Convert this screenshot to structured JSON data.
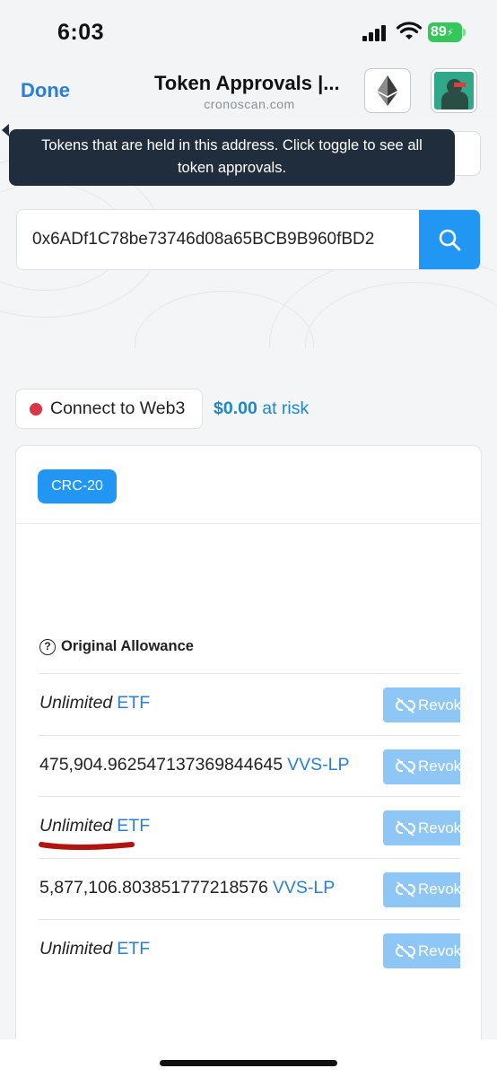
{
  "status_bar": {
    "time": "6:03",
    "battery": "89"
  },
  "nav": {
    "done_label": "Done",
    "title": "Token Approvals |...",
    "domain": "cronoscan.com"
  },
  "search": {
    "value": "0x6ADf1C78be73746d08a65BCB9B960fBD2"
  },
  "tooltip": {
    "text": "Tokens that are held in this address. Click toggle to see all token approvals."
  },
  "connect": {
    "label": "Connect to Web3"
  },
  "risk": {
    "amount": "$0.00",
    "label": " at risk"
  },
  "card": {
    "tab_label": "CRC-20",
    "column_header": "Original Allowance",
    "rows": [
      {
        "amount": "Unlimited",
        "token": "ETF",
        "revoke": "Revoke"
      },
      {
        "amount": "475,904.962547137369844645",
        "token": "VVS-LP",
        "revoke": "Revoke"
      },
      {
        "amount": "Unlimited",
        "token": "ETF",
        "revoke": "Revoke"
      },
      {
        "amount": "5,877,106.803851777218576",
        "token": "VVS-LP",
        "revoke": "Revoke"
      },
      {
        "amount": "Unlimited",
        "token": "ETF",
        "revoke": "Revoke"
      }
    ]
  },
  "colors": {
    "accent": "#2196f3",
    "link": "#2a7fd4",
    "tooltip_bg": "#1f2d3d",
    "revoke_bg": "#8ec7f6",
    "dot_red": "#dc3545",
    "annotation_red": "#b0150f"
  }
}
